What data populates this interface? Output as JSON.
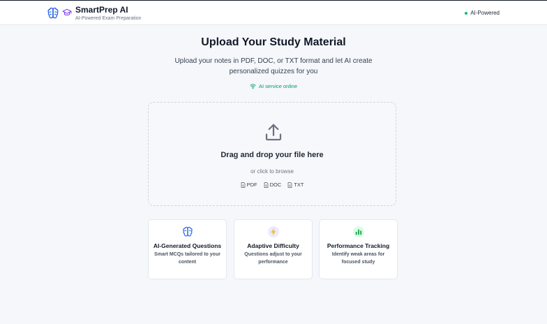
{
  "header": {
    "app_name": "SmartPrep AI",
    "tagline": "AI-Powered Exam Preparation",
    "status_label": "AI-Powered",
    "logo_icons": [
      "brain-icon",
      "graduation-cap-icon"
    ]
  },
  "hero": {
    "title": "Upload Your Study Material",
    "subtitle": "Upload your notes in PDF, DOC, or TXT format and let AI create personalized quizzes for you",
    "service_status": "AI service online"
  },
  "dropzone": {
    "icon": "upload-icon",
    "title": "Drag and drop your file here",
    "browse_text": "or click to browse",
    "formats": [
      "PDF",
      "DOC",
      "TXT"
    ]
  },
  "features": [
    {
      "icon": "brain-icon",
      "title": "AI-Generated Questions",
      "description": "Smart MCQs tailored to your content"
    },
    {
      "icon": "lightning-icon",
      "title": "Adaptive Difficulty",
      "description": "Questions adjust to your performance"
    },
    {
      "icon": "bar-chart-icon",
      "title": "Performance Tracking",
      "description": "Identify weak areas for focused study"
    }
  ],
  "colors": {
    "accent_blue": "#2563eb",
    "accent_purple": "#7c3aed",
    "success_green": "#10b981",
    "background": "#f5f7fb"
  }
}
